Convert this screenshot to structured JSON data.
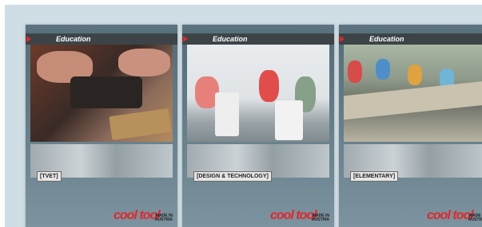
{
  "cards": [
    {
      "series": "Education",
      "brand": "cool tool",
      "tag": "[TVET]",
      "logo_word": "cool tool",
      "logo_tagline": "MADE IN AUSTRIA"
    },
    {
      "series": "Education",
      "brand": "cool tool",
      "tag": "[DESIGN & TECHNOLOGY]",
      "logo_word": "cool tool",
      "logo_tagline": "MADE IN AUSTRIA"
    },
    {
      "series": "Education",
      "brand": "cool tool",
      "tag": "[ELEMENTARY]",
      "logo_word": "cool tool",
      "logo_tagline": "MADE IN AUSTRIA"
    }
  ],
  "colors": {
    "brand_red": "#e2262b",
    "header_strip": "#3d4447",
    "card_blue": "#5d7582",
    "background_panel": "#cfdde4"
  }
}
